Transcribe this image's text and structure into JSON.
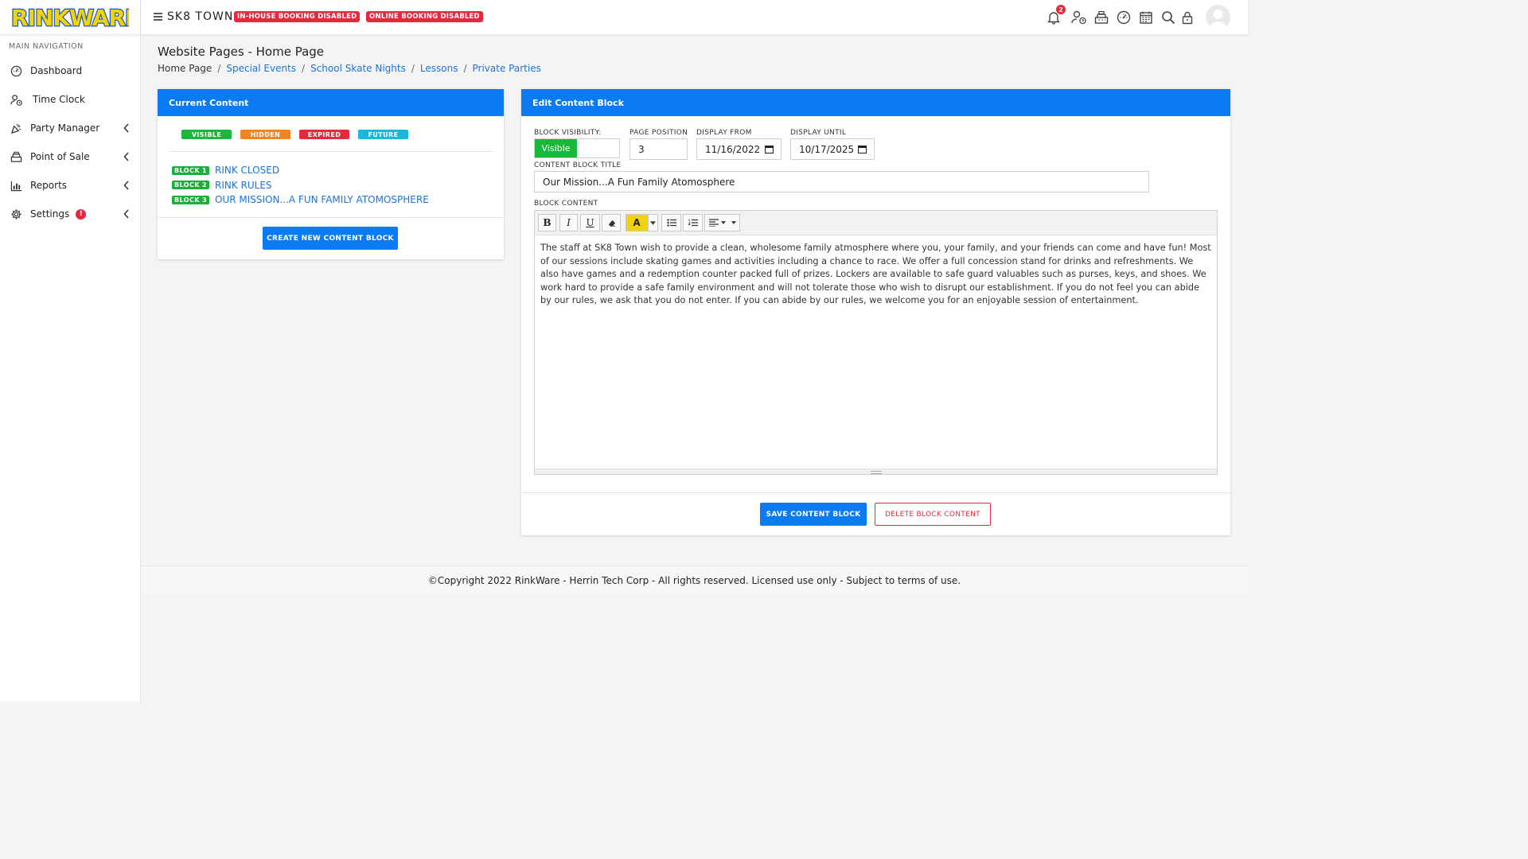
{
  "brand": {
    "logo_text": "RINKWARE"
  },
  "sidebar": {
    "heading": "MAIN NAVIGATION",
    "items": [
      {
        "label": "Dashboard",
        "icon": "dashboard-gauge-icon"
      },
      {
        "label": "Time Clock",
        "icon": "user-clock-icon"
      },
      {
        "label": "Party Manager",
        "icon": "party-popper-icon",
        "has_submenu": true
      },
      {
        "label": "Point of Sale",
        "icon": "cash-register-icon",
        "has_submenu": true
      },
      {
        "label": "Reports",
        "icon": "bar-chart-icon",
        "has_submenu": true
      },
      {
        "label": "Settings",
        "icon": "gear-icon",
        "has_submenu": true,
        "badge": "!"
      }
    ]
  },
  "topbar": {
    "venue": "SK8 TOWN",
    "badges": [
      "IN-HOUSE BOOKING DISABLED",
      "ONLINE BOOKING DISABLED"
    ],
    "notification_count": "2",
    "icons": [
      "bell-icon",
      "user-clock-icon",
      "cash-register-icon",
      "dashboard-gauge-icon",
      "calendar-icon",
      "search-icon",
      "lock-icon",
      "user-avatar"
    ]
  },
  "page": {
    "title": "Website Pages - Home Page",
    "breadcrumb": [
      "Home Page",
      "Special Events",
      "School Skate Nights",
      "Lessons",
      "Private Parties"
    ]
  },
  "current_content": {
    "header": "Current Content",
    "legend": [
      {
        "label": "VISIBLE",
        "color": "#1ab83a"
      },
      {
        "label": "HIDDEN",
        "color": "#f5841f"
      },
      {
        "label": "EXPIRED",
        "color": "#e8283c"
      },
      {
        "label": "FUTURE",
        "color": "#17b8d9"
      }
    ],
    "blocks": [
      {
        "badge": "BLOCK 1",
        "title": "RINK CLOSED"
      },
      {
        "badge": "BLOCK 2",
        "title": "RINK RULES"
      },
      {
        "badge": "BLOCK 3",
        "title": "OUR MISSION...A FUN FAMILY ATOMOSPHERE"
      }
    ],
    "create_button": "CREATE NEW CONTENT BLOCK"
  },
  "edit_block": {
    "header": "Edit Content Block",
    "visibility_label": "BLOCK VISIBILITY:",
    "visibility_value": "Visible",
    "position_label": "PAGE POSITION",
    "position_value": "3",
    "from_label": "DISPLAY FROM",
    "from_value": "11/16/2022",
    "until_label": "DISPLAY UNTIL",
    "until_value": "10/17/2025",
    "title_label": "CONTENT BLOCK TITLE",
    "title_value": "Our Mission...A Fun Family Atomosphere",
    "content_label": "BLOCK CONTENT",
    "content_text": "The staff at SK8 Town wish to provide a clean, wholesome family atmosphere where you, your family, and your friends can come and have fun! Most of our sessions include skating games and activities including a chance to race. We offer a full concession stand for drinks and refreshments. We also have games and a redemption counter packed full of prizes. Lockers are available to safe guard valuables such as purses, keys, and shoes. We work hard to provide a safe family environment and will not tolerate those who wish to disrupt our establishment. If you do not feel you can abide by our rules, we ask that you do not enter. If you can abide by our rules, we welcome you for an enjoyable session of entertainment.",
    "toolbar": {
      "bold": "B",
      "italic": "I",
      "underline": "U"
    },
    "save_button": "SAVE CONTENT BLOCK",
    "delete_button": "DELETE BLOCK CONTENT"
  },
  "footer": {
    "text": "©Copyright 2022 RinkWare - Herrin Tech Corp - All rights reserved. Licensed use only - Subject to terms of use."
  }
}
